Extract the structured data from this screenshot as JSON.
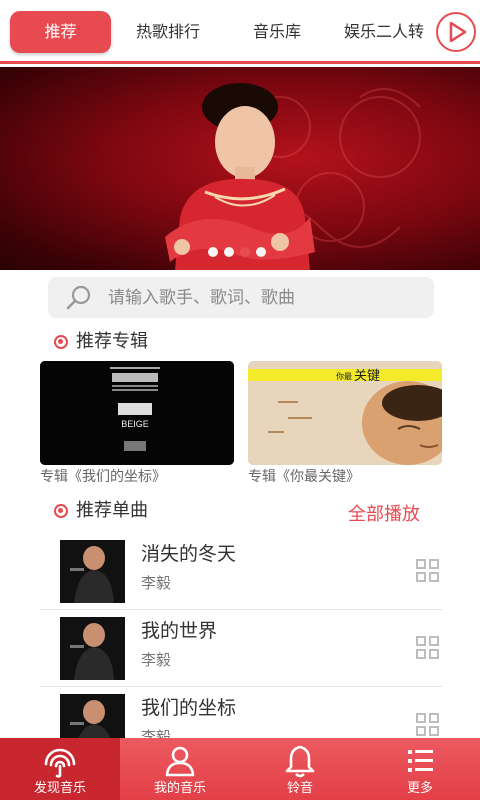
{
  "tabs": [
    {
      "label": "推荐",
      "active": true
    },
    {
      "label": "热歌排行"
    },
    {
      "label": "音乐库"
    },
    {
      "label": "娱乐二人转"
    }
  ],
  "player_icon": "play-circle-icon",
  "banner": {
    "slide_count": 4,
    "active_index": 2
  },
  "search": {
    "placeholder": "请输入歌手、歌词、歌曲",
    "icon": "search-icon"
  },
  "albums_section": {
    "title": "推荐专辑"
  },
  "albums": [
    {
      "caption": "专辑《我们的坐标》",
      "cover_text": "BEIGE"
    },
    {
      "caption": "专辑《你最关键》",
      "cover_text_small": "你最",
      "cover_text_big": "关键"
    }
  ],
  "songs_section": {
    "title": "推荐单曲",
    "play_all": "全部播放"
  },
  "songs": [
    {
      "title": "消失的冬天",
      "artist": "李毅"
    },
    {
      "title": "我的世界",
      "artist": "李毅"
    },
    {
      "title": "我们的坐标",
      "artist": "李毅"
    }
  ],
  "bottom_nav": [
    {
      "label": "发现音乐",
      "icon": "discover-icon",
      "active": true
    },
    {
      "label": "我的音乐",
      "icon": "user-icon"
    },
    {
      "label": "铃音",
      "icon": "bell-icon"
    },
    {
      "label": "更多",
      "icon": "list-icon"
    }
  ],
  "colors": {
    "accent": "#e84a51",
    "nav_active": "#c9272f",
    "banner_red": "#b3121c"
  }
}
